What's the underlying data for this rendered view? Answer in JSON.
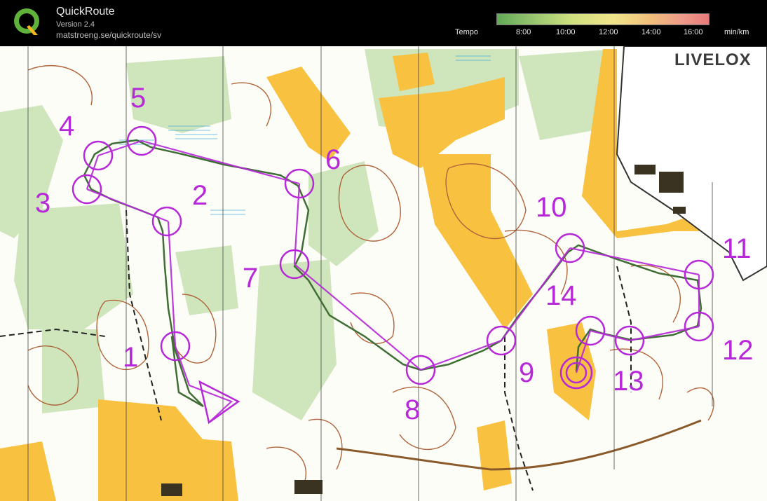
{
  "app": {
    "name": "QuickRoute",
    "version": "Version 2.4",
    "url": "matstroeng.se/quickroute/sv"
  },
  "tempo": {
    "label": "Tempo",
    "ticks": [
      "8:00",
      "10:00",
      "12:00",
      "14:00",
      "16:00"
    ],
    "unit": "min/km"
  },
  "watermark": "LIVELOX",
  "controls": [
    "1",
    "2",
    "3",
    "4",
    "5",
    "6",
    "7",
    "8",
    "9",
    "10",
    "11",
    "12",
    "13",
    "14"
  ],
  "colors": {
    "course": "#b628d8",
    "route": "#3f6e35",
    "open_land": "#f9c23c",
    "forest": "#ffffff",
    "green": "#c9e4b3",
    "contour": "#a0522d"
  }
}
